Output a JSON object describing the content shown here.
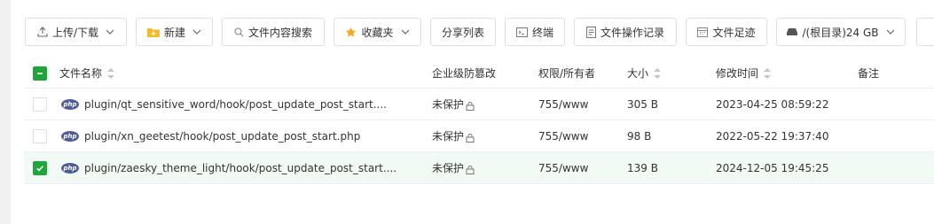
{
  "toolbar": {
    "upload_download": "上传/下载",
    "new": "新建",
    "content_search": "文件内容搜索",
    "favorites": "收藏夹",
    "share_list": "分享列表",
    "terminal": "终端",
    "operation_log": "文件操作记录",
    "footprint": "文件足迹",
    "disk": "/(根目录)24 GB"
  },
  "columns": {
    "name": "文件名称",
    "tamper": "企业级防篡改",
    "perm": "权限/所有者",
    "size": "大小",
    "mtime": "修改时间",
    "remark": "备注"
  },
  "files": [
    {
      "icon": "php-file-icon",
      "name": "plugin/qt_sensitive_word/hook/post_update_post_start....",
      "protect": "未保护",
      "perm": "755/www",
      "size": "305 B",
      "mtime": "2023-04-25 08:59:22",
      "checked": false
    },
    {
      "icon": "php-file-icon",
      "name": "plugin/xn_geetest/hook/post_update_post_start.php",
      "protect": "未保护",
      "perm": "755/www",
      "size": "98 B",
      "mtime": "2022-05-22 19:37:40",
      "checked": false
    },
    {
      "icon": "php-file-icon",
      "name": "plugin/zaesky_theme_light/hook/post_update_post_start....",
      "protect": "未保护",
      "perm": "755/www",
      "size": "139 B",
      "mtime": "2024-12-05 19:45:25",
      "checked": true
    }
  ],
  "php_badge_text": "php",
  "colors": {
    "accent": "#20a53a",
    "selected_row": "#f2faf5",
    "php_badge": "#4f5b93",
    "star": "#f5a623",
    "folder": "#f7ba2a"
  }
}
